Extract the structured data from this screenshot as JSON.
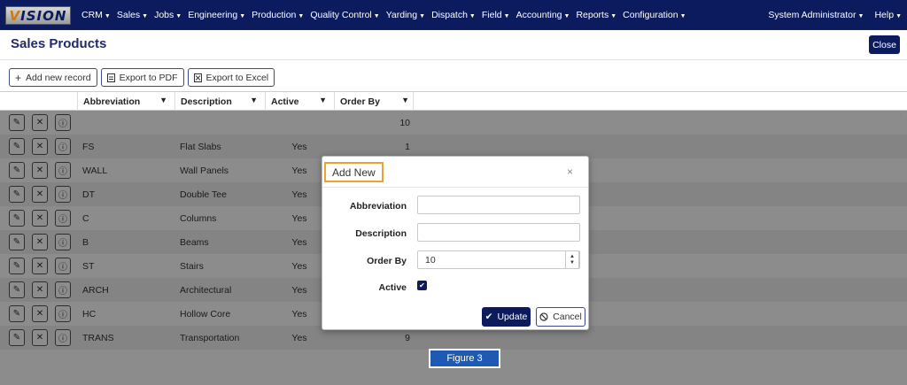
{
  "app": {
    "logo_text": "VISION"
  },
  "nav": {
    "items": [
      {
        "label": "CRM"
      },
      {
        "label": "Sales"
      },
      {
        "label": "Jobs"
      },
      {
        "label": "Engineering"
      },
      {
        "label": "Production"
      },
      {
        "label": "Quality Control"
      },
      {
        "label": "Yarding"
      },
      {
        "label": "Dispatch"
      },
      {
        "label": "Field"
      },
      {
        "label": "Accounting"
      },
      {
        "label": "Reports"
      },
      {
        "label": "Configuration"
      }
    ],
    "user": "System Administrator",
    "help": "Help"
  },
  "page": {
    "title": "Sales Products",
    "close_label": "Close"
  },
  "toolbar": {
    "add_label": "Add new record",
    "pdf_label": "Export to PDF",
    "excel_label": "Export to Excel"
  },
  "grid": {
    "columns": [
      "Abbreviation",
      "Description",
      "Active",
      "Order By"
    ],
    "rows": [
      {
        "abbreviation": "",
        "description": "",
        "active": "",
        "order_by": "10"
      },
      {
        "abbreviation": "FS",
        "description": "Flat Slabs",
        "active": "Yes",
        "order_by": "1"
      },
      {
        "abbreviation": "WALL",
        "description": "Wall Panels",
        "active": "Yes",
        "order_by": ""
      },
      {
        "abbreviation": "DT",
        "description": "Double Tee",
        "active": "Yes",
        "order_by": ""
      },
      {
        "abbreviation": "C",
        "description": "Columns",
        "active": "Yes",
        "order_by": ""
      },
      {
        "abbreviation": "B",
        "description": "Beams",
        "active": "Yes",
        "order_by": ""
      },
      {
        "abbreviation": "ST",
        "description": "Stairs",
        "active": "Yes",
        "order_by": ""
      },
      {
        "abbreviation": "ARCH",
        "description": "Architectural",
        "active": "Yes",
        "order_by": ""
      },
      {
        "abbreviation": "HC",
        "description": "Hollow Core",
        "active": "Yes",
        "order_by": ""
      },
      {
        "abbreviation": "TRANS",
        "description": "Transportation",
        "active": "Yes",
        "order_by": "9"
      }
    ]
  },
  "modal": {
    "title": "Add New",
    "close_symbol": "×",
    "fields": {
      "abbreviation_label": "Abbreviation",
      "abbreviation_value": "",
      "description_label": "Description",
      "description_value": "",
      "order_by_label": "Order By",
      "order_by_value": "10",
      "active_label": "Active",
      "active_checked": true
    },
    "update_label": "Update",
    "cancel_label": "Cancel"
  },
  "annotation": {
    "figure_label": "Figure 3"
  },
  "colors": {
    "navy": "#0b1b5e",
    "highlight": "#f0a030",
    "figure_blue": "#1e5ab4"
  }
}
